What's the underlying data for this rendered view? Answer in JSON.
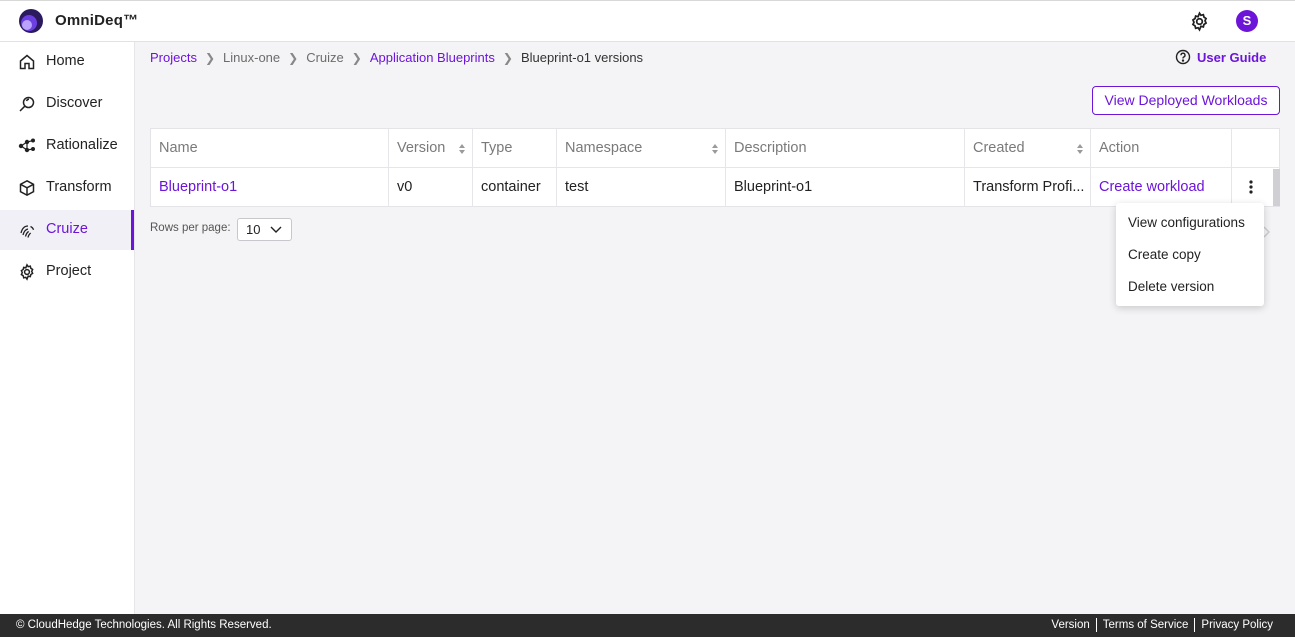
{
  "app": {
    "name": "OmniDeq™",
    "avatar_letter": "S"
  },
  "colors": {
    "accent": "#6c15d8",
    "footer_bg": "#2c2c2c"
  },
  "sidebar": {
    "items": [
      {
        "label": "Home",
        "icon": "home-icon"
      },
      {
        "label": "Discover",
        "icon": "magnifier-icon"
      },
      {
        "label": "Rationalize",
        "icon": "network-icon"
      },
      {
        "label": "Transform",
        "icon": "cube-icon"
      },
      {
        "label": "Cruize",
        "icon": "fingerprint-icon",
        "active": true
      },
      {
        "label": "Project",
        "icon": "gear-icon"
      }
    ]
  },
  "breadcrumb": {
    "items": [
      "Projects",
      "Linux-one",
      "Cruize",
      "Application Blueprints",
      "Blueprint-o1 versions"
    ]
  },
  "user_guide": "User Guide",
  "deploy_button": "View Deployed Workloads",
  "table": {
    "headers": [
      "Name",
      "Version",
      "Type",
      "Namespace",
      "Description",
      "Created",
      "Action"
    ],
    "rows": [
      [
        "Blueprint-o1",
        "v0",
        "container",
        "test",
        "Blueprint-o1",
        "Transform Profi...",
        "Create workload"
      ]
    ]
  },
  "pagination": {
    "rows_label": "Rows per page:",
    "rows_value": "10"
  },
  "menu": {
    "items": [
      "View configurations",
      "Create copy",
      "Delete version"
    ]
  },
  "footer": {
    "copyright": "© CloudHedge Technologies. All Rights Reserved.",
    "links": [
      "Version",
      "Terms of Service",
      "Privacy Policy"
    ]
  }
}
